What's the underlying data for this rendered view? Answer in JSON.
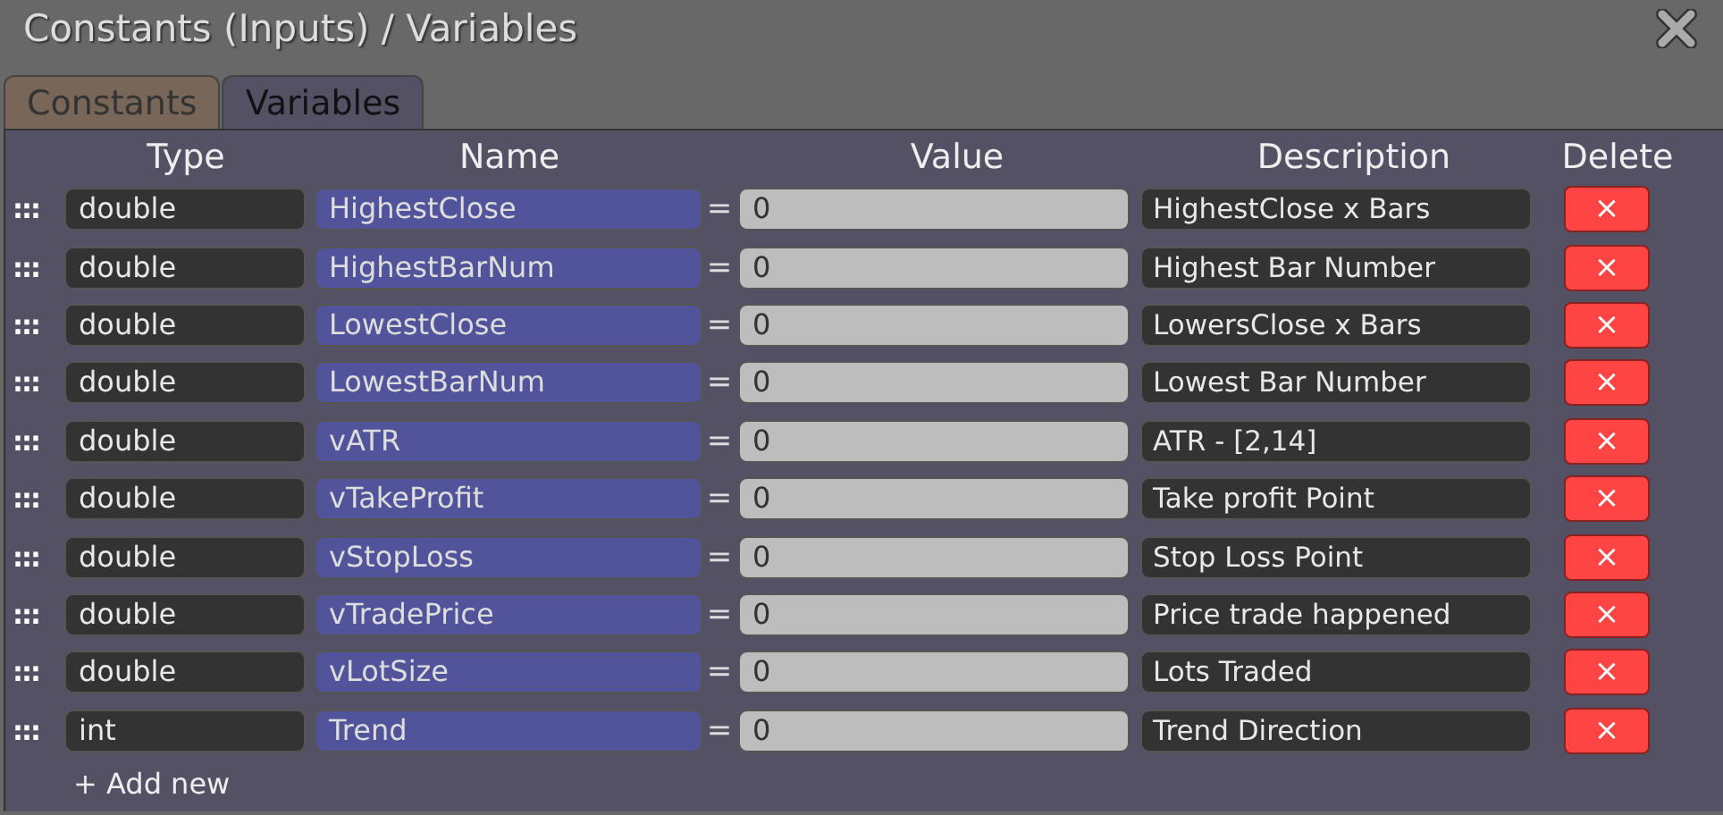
{
  "window": {
    "title": "Constants (Inputs) / Variables"
  },
  "tabs": [
    {
      "label": "Constants",
      "selected": false
    },
    {
      "label": "Variables",
      "selected": true
    }
  ],
  "table": {
    "columns": [
      "Type",
      "Name",
      "Value",
      "Description",
      "Delete"
    ],
    "rows": [
      {
        "grip": ":::",
        "type": "double",
        "name": "HighestClose",
        "equals": "=",
        "value": "0",
        "description": "HighestClose x Bars",
        "delete": "×"
      },
      {
        "grip": ":::",
        "type": "double",
        "name": "HighestBarNum",
        "equals": "=",
        "value": "0",
        "description": "Highest Bar Number",
        "delete": "×"
      },
      {
        "grip": ":::",
        "type": "double",
        "name": "LowestClose",
        "equals": "=",
        "value": "0",
        "description": "LowersClose x Bars",
        "delete": "×"
      },
      {
        "grip": ":::",
        "type": "double",
        "name": "LowestBarNum",
        "equals": "=",
        "value": "0",
        "description": "Lowest Bar Number",
        "delete": "×"
      },
      {
        "grip": ":::",
        "type": "double",
        "name": "vATR",
        "equals": "=",
        "value": "0",
        "description": "ATR - [2,14]",
        "delete": "×"
      },
      {
        "grip": ":::",
        "type": "double",
        "name": "vTakeProfit",
        "equals": "=",
        "value": "0",
        "description": "Take profit Point",
        "delete": "×"
      },
      {
        "grip": ":::",
        "type": "double",
        "name": "vStopLoss",
        "equals": "=",
        "value": "0",
        "description": "Stop Loss Point",
        "delete": "×"
      },
      {
        "grip": ":::",
        "type": "double",
        "name": "vTradePrice",
        "equals": "=",
        "value": "0",
        "description": "Price trade happened",
        "delete": "×"
      },
      {
        "grip": ":::",
        "type": "double",
        "name": "vLotSize",
        "equals": "=",
        "value": "0",
        "description": "Lots Traded",
        "delete": "×"
      },
      {
        "grip": ":::",
        "type": "int",
        "name": "Trend",
        "equals": "=",
        "value": "0",
        "description": "Trend Direction",
        "delete": "×"
      }
    ]
  },
  "add_button": {
    "label": "+ Add new"
  }
}
